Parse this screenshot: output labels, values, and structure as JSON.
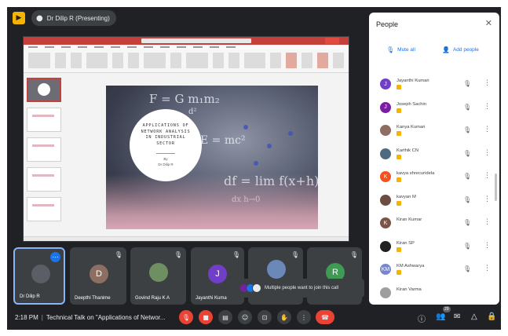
{
  "presenter": {
    "label": "Dr Dilip R (Presenting)"
  },
  "slide": {
    "title": "APPLICATIONS OF NETWORK ANALYSIS IN INDUSTRIAL SECTOR",
    "by": "By",
    "author": "Dr Dilip R"
  },
  "tiles": [
    {
      "name": "Dr Dilip R",
      "initial": "",
      "color": "#5b5e66"
    },
    {
      "name": "Deepthi Thanime",
      "initial": "D",
      "color": "#8d6e63"
    },
    {
      "name": "Govind Raju K A",
      "initial": "",
      "color": "#6f8f62"
    },
    {
      "name": "Jayanthi Kuma",
      "initial": "J",
      "color": "#6f3fc8"
    },
    {
      "name": "",
      "initial": "",
      "color": "#6a89b8"
    },
    {
      "name": "",
      "initial": "R",
      "color": "#3f9a53"
    }
  ],
  "join_toast": {
    "text": "Multiple people want to join this call"
  },
  "people_panel": {
    "title": "People",
    "mute_all": "Mute all",
    "add_people": "Add people",
    "participants": [
      {
        "name": "Jayanthi Kumari",
        "initial": "J",
        "color": "#6f3fc8"
      },
      {
        "name": "Joseph Sachin",
        "initial": "J",
        "color": "#7b1fa2"
      },
      {
        "name": "Kanya Kumari",
        "initial": "",
        "color": "#8d6e63"
      },
      {
        "name": "Karthik CN",
        "initial": "",
        "color": "#4e6a80"
      },
      {
        "name": "kavya shrecuridela",
        "initial": "K",
        "color": "#f4511e"
      },
      {
        "name": "kavyan M",
        "initial": "",
        "color": "#6d4c41"
      },
      {
        "name": "Kiran Kumar",
        "initial": "K",
        "color": "#795548"
      },
      {
        "name": "Kiran SP",
        "initial": "",
        "color": "#212121"
      },
      {
        "name": "KM Ashwarya",
        "initial": "KM",
        "color": "#7986cb"
      },
      {
        "name": "Kiran Varma",
        "initial": "",
        "color": "#9e9e9e"
      }
    ]
  },
  "meeting": {
    "time": "2:18 PM",
    "title": "Technical Talk on \"Applications of Networ..."
  },
  "participant_count": "29",
  "colors": {
    "accent": "#1a73e8",
    "end_call": "#ea4335",
    "background": "#202124"
  }
}
